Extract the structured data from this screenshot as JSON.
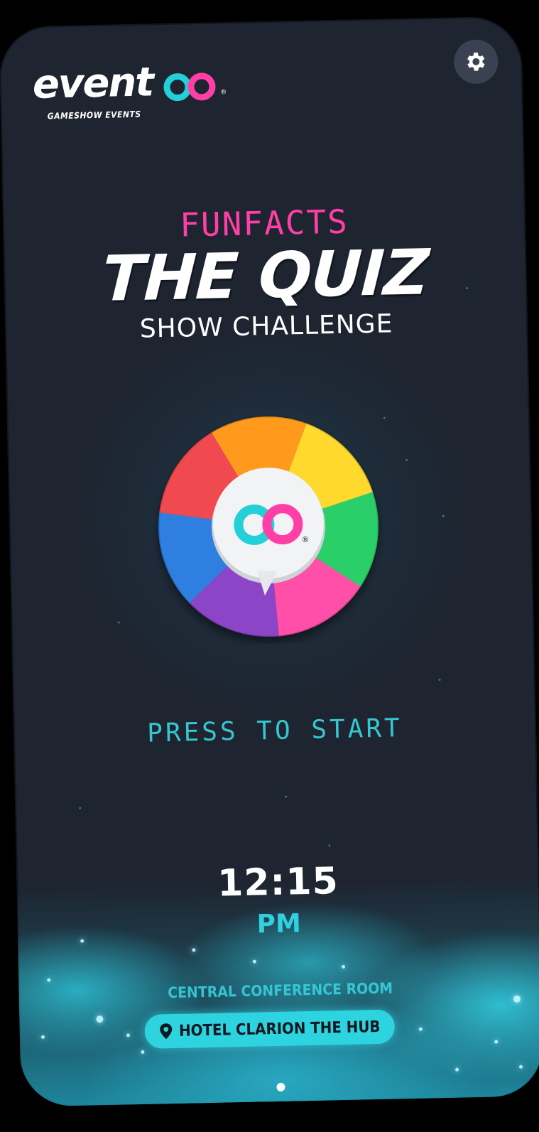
{
  "brand": {
    "name": "eventoo",
    "name_prefix": "event",
    "registered": "®",
    "tagline": "GAMESHOW EVENTS"
  },
  "header": {
    "settings_icon": "gear-icon"
  },
  "titles": {
    "kicker": "FUNFACTS",
    "main": "THE QUIZ",
    "subtitle": "SHOW CHALLENGE"
  },
  "wheel": {
    "segment_colors": [
      "#ff9a1f",
      "#ffd92e",
      "#2ccf6a",
      "#ff4fa8",
      "#8b44c6",
      "#2f7fe0",
      "#f04a4f"
    ],
    "ring_colors": [
      "#23d0d8",
      "#ff3fa6"
    ],
    "registered": "®"
  },
  "prompt": {
    "start_label": "PRESS TO START"
  },
  "clock": {
    "time": "12:15",
    "period": "PM"
  },
  "location": {
    "room": "CENTRAL CONFERENCE ROOM",
    "venue": "HOTEL CLARION THE HUB",
    "pin_icon": "location-pin-icon"
  },
  "pager": {
    "current": 1,
    "total": 1
  },
  "colors": {
    "background": "#1e2430",
    "accent_pink": "#ff3fa6",
    "accent_cyan": "#35c6cf"
  }
}
